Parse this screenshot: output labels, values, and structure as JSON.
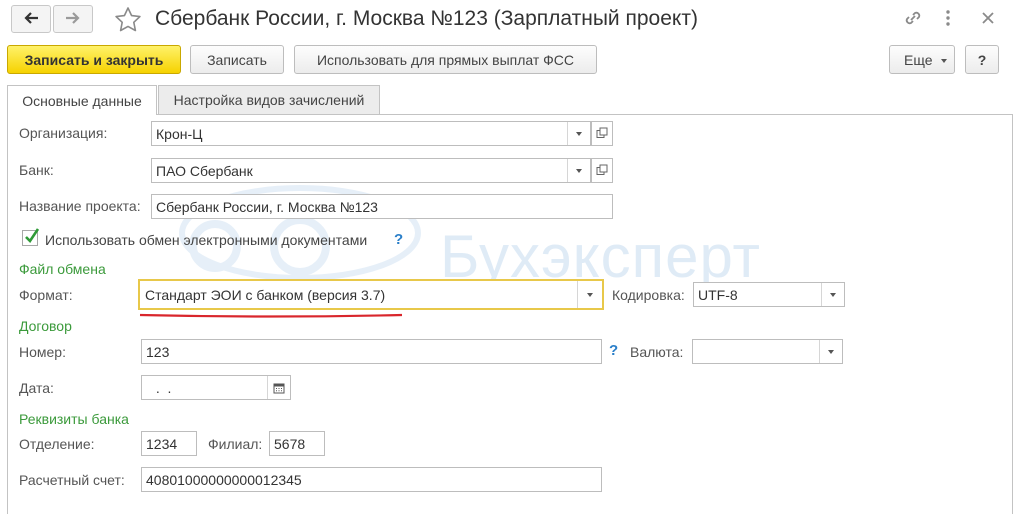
{
  "window": {
    "title": "Сбербанк России, г. Москва №123 (Зарплатный проект)",
    "icons": [
      "arrow-left-icon",
      "arrow-right-icon",
      "star-icon",
      "link-icon",
      "more-vertical-icon",
      "close-icon"
    ]
  },
  "toolbar": {
    "save_close": "Записать и закрыть",
    "save": "Записать",
    "use_fss": "Использовать для прямых выплат ФСС",
    "more": "Еще",
    "help": "?"
  },
  "tabs": [
    {
      "label": "Основные данные",
      "active": true
    },
    {
      "label": "Настройка видов зачислений",
      "active": false
    }
  ],
  "form": {
    "organization": {
      "label": "Организация:",
      "value": "Крон-Ц"
    },
    "bank": {
      "label": "Банк:",
      "value": "ПАО Сбербанк"
    },
    "project_name": {
      "label": "Название проекта:",
      "value": "Сбербанк России, г. Москва №123"
    },
    "use_edo": {
      "label": "Использовать обмен электронными документами",
      "checked": true,
      "help": "?"
    },
    "exchange_file": {
      "group": "Файл обмена",
      "format_label": "Формат:",
      "format_value": "Стандарт ЭОИ с банком (версия 3.7)",
      "encoding_label": "Кодировка:",
      "encoding_value": "UTF-8"
    },
    "contract": {
      "group": "Договор",
      "number_label": "Номер:",
      "number_value": "123",
      "number_help": "?",
      "currency_label": "Валюта:",
      "currency_value": "",
      "date_label": "Дата:",
      "date_value": " .  ."
    },
    "bank_details": {
      "group": "Реквизиты банка",
      "branch_label": "Отделение:",
      "branch_value": "1234",
      "filial_label": "Филиал:",
      "filial_value": "5678",
      "account_label": "Расчетный счет:",
      "account_value": "40801000000000012345"
    }
  },
  "watermark": "Бухэксперт",
  "colors": {
    "primary_button": "#f6d200",
    "group_label": "#3b9a3b",
    "help": "#2a7fc9",
    "highlight_border": "#e8c84a",
    "annotation_underline": "#d9262c"
  }
}
